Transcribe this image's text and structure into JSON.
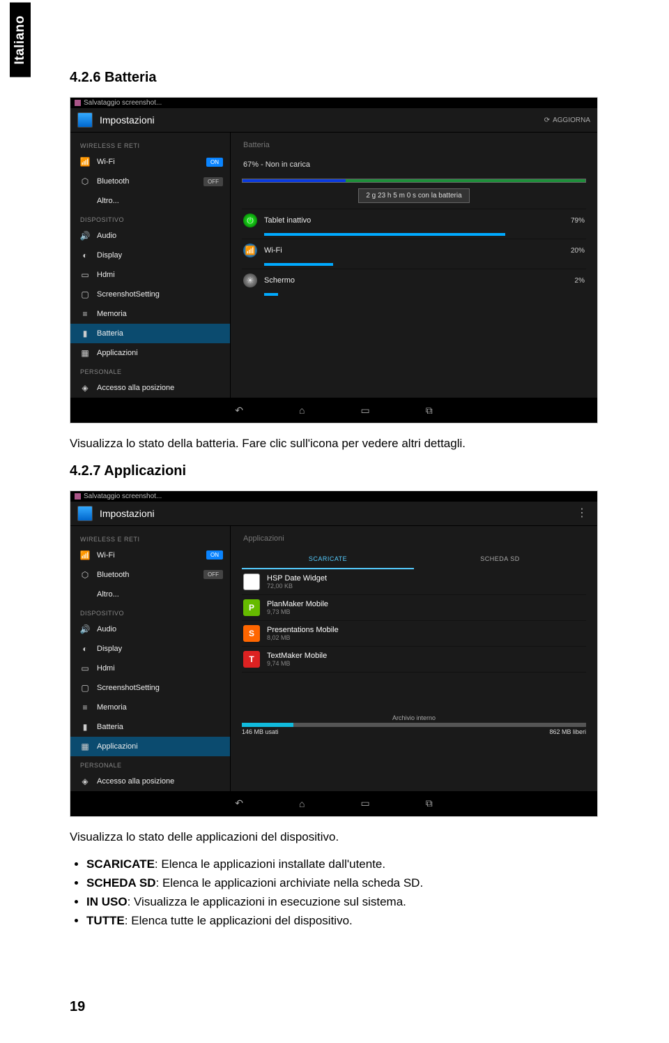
{
  "side_tab": "Italiano",
  "section1": {
    "heading": "4.2.6  Batteria",
    "paragraph": "Visualizza lo stato della batteria. Fare clic sull'icona per vedere altri dettagli."
  },
  "section2": {
    "heading": "4.2.7  Applicazioni",
    "intro": "Visualizza lo stato delle applicazioni del dispositivo.",
    "bullets": [
      {
        "label": "SCARICATE",
        "text": ": Elenca le applicazioni installate dall'utente."
      },
      {
        "label": "SCHEDA SD",
        "text": ": Elenca le applicazioni archiviate nella scheda SD."
      },
      {
        "label": "IN USO",
        "text": ": Visualizza le applicazioni in esecuzione sul sistema."
      },
      {
        "label": "TUTTE",
        "text": ": Elenca tutte le applicazioni del dispositivo."
      }
    ]
  },
  "page_number": "19",
  "shot_common": {
    "status_text": "Salvataggio screenshot...",
    "app_title": "Impostazioni",
    "refresh_label": "AGGIORNA",
    "sidebar": {
      "cat_wireless": "WIRELESS E RETI",
      "wifi": "Wi-Fi",
      "wifi_toggle": "ON",
      "bluetooth": "Bluetooth",
      "bt_toggle": "OFF",
      "altro": "Altro...",
      "cat_device": "DISPOSITIVO",
      "audio": "Audio",
      "display": "Display",
      "hdmi": "Hdmi",
      "screenshot": "ScreenshotSetting",
      "memoria": "Memoria",
      "batteria": "Batteria",
      "applicazioni": "Applicazioni",
      "cat_personal": "PERSONALE",
      "posizione": "Accesso alla posizione"
    }
  },
  "shot1": {
    "content_header": "Batteria",
    "summary": "67% - Non in carica",
    "duration": "2 g 23 h 5 m 0 s con la batteria",
    "usage": [
      {
        "label": "Tablet inattivo",
        "pct": "79%",
        "bar_width": "79%"
      },
      {
        "label": "Wi-Fi",
        "pct": "20%",
        "bar_width": "20%"
      },
      {
        "label": "Schermo",
        "pct": "2%",
        "bar_width": "4%"
      }
    ]
  },
  "shot2": {
    "content_header": "Applicazioni",
    "tabs": {
      "scaricate": "SCARICATE",
      "scheda": "SCHEDA SD"
    },
    "apps": [
      {
        "name": "HSP Date Widget",
        "size": "72,00 KB"
      },
      {
        "name": "PlanMaker Mobile",
        "size": "9,73 MB"
      },
      {
        "name": "Presentations Mobile",
        "size": "8,02 MB"
      },
      {
        "name": "TextMaker Mobile",
        "size": "9,74 MB"
      }
    ],
    "storage_label": "Archivio interno",
    "storage_used": "146 MB usati",
    "storage_free": "862 MB liberi"
  }
}
